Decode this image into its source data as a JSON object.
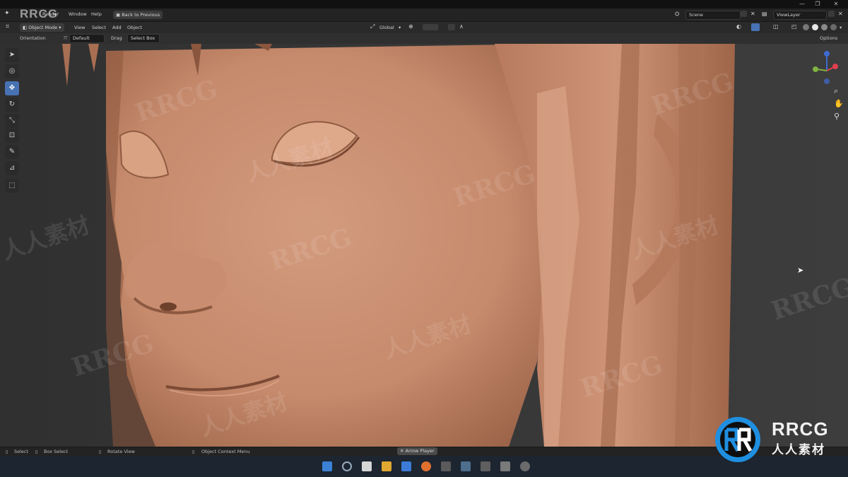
{
  "window": {
    "minimize": "—",
    "maximize": "❐",
    "close": "✕"
  },
  "menu": {
    "items": [
      "Render",
      "Window",
      "Help"
    ],
    "back_button": "Back to Previous",
    "scene_label": "Scene",
    "viewlayer_label": "ViewLayer"
  },
  "header": {
    "mode": "Object Mode",
    "items": [
      "View",
      "Select",
      "Add",
      "Object"
    ],
    "transform_orientation": "Global"
  },
  "tool_settings": {
    "orientation_label": "Orientation",
    "orientation_value": "Default",
    "drag_label": "Drag",
    "drag_value": "Select Box",
    "options_label": "Options"
  },
  "statusbar": {
    "items": [
      "Select",
      "Box Select",
      "Rotate View",
      "Object Context Menu"
    ],
    "center_pill": "Arrow Player"
  },
  "watermark": {
    "brand": "RRCG",
    "brand_cn": "人人素材"
  },
  "colors": {
    "accent": "#4772b3",
    "skin": "#c98f73",
    "axis_x": "#e0414f",
    "axis_y": "#7fb341",
    "axis_z": "#3f6bd1"
  }
}
